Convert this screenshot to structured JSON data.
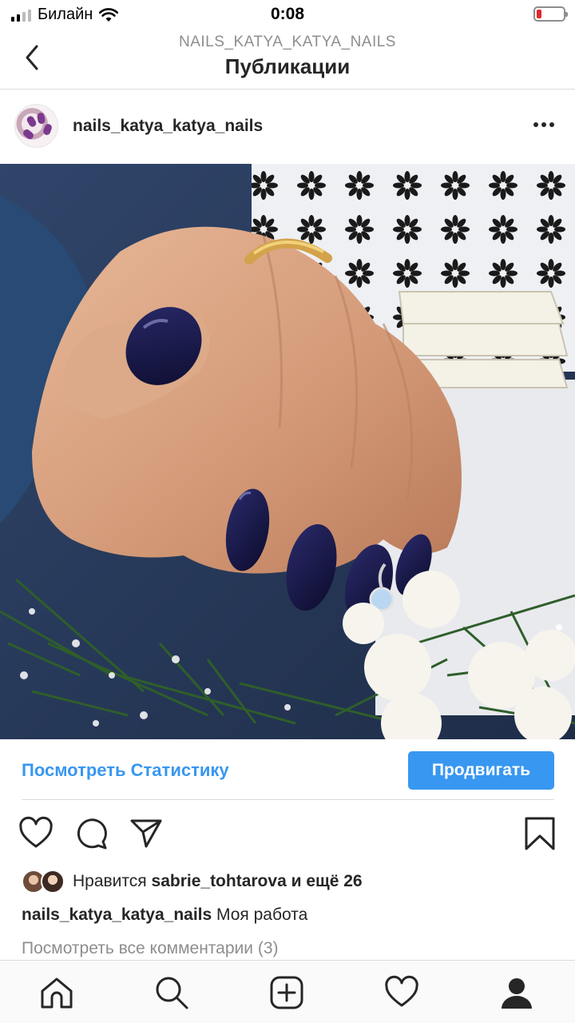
{
  "status_bar": {
    "carrier": "Билайн",
    "time": "0:08",
    "battery_level": 0.18,
    "battery_color": "#e0282a"
  },
  "header": {
    "subtitle": "NAILS_KATYA_KATYA_NAILS",
    "title": "Публикации",
    "back_icon": "chevron-left-icon"
  },
  "post": {
    "username": "nails_katya_katya_nails",
    "more_icon": "more-horizontal-icon"
  },
  "promo_bar": {
    "stats_link": "Посмотреть Статистику",
    "promote_button": "Продвигать",
    "accent_color": "#3897f0"
  },
  "actions": {
    "like_icon": "heart-icon",
    "comment_icon": "comment-icon",
    "share_icon": "send-icon",
    "save_icon": "bookmark-icon"
  },
  "likes": {
    "prefix": "Нравится",
    "user": "sabrie_tohtarova",
    "suffix": "и ещё 26"
  },
  "caption": {
    "username": "nails_katya_katya_nails",
    "text": "Моя работа"
  },
  "comments_link": "Посмотреть все комментарии (3)",
  "tab_bar": {
    "items": [
      "home-icon",
      "search-icon",
      "new-post-icon",
      "activity-icon",
      "profile-icon"
    ]
  }
}
